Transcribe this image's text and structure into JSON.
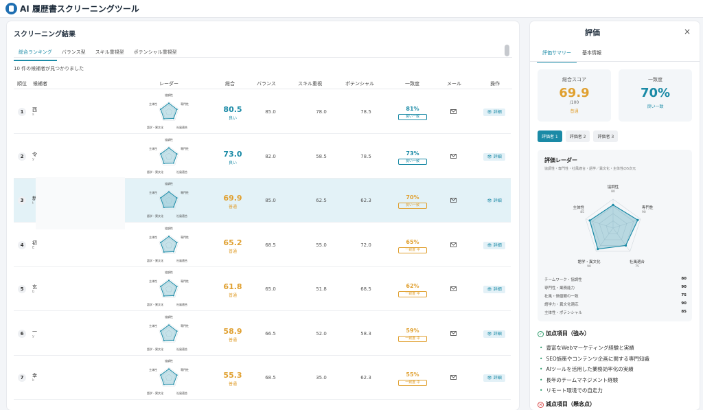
{
  "app": {
    "title": "AI 履歴書スクリーニングツール"
  },
  "left": {
    "title": "スクリーニング結果",
    "tabs": [
      "総合ランキング",
      "バランス型",
      "スキル重視型",
      "ポテンシャル重視型"
    ],
    "found": "10 件の候補者が見つかりました",
    "headers": {
      "rank": "順位",
      "candidate": "候補者",
      "radar": "レーダー",
      "total": "総合",
      "balance": "バランス",
      "skill": "スキル重視",
      "potential": "ポテンシャル",
      "match": "一致度",
      "mail": "メール",
      "action": "操作"
    },
    "radar_labels": {
      "top": "協調性",
      "right": "専門性",
      "br": "社風適合",
      "bl": "語学・異文化",
      "left": "主体性"
    },
    "detail_label": "詳細",
    "rows": [
      {
        "rank": "1",
        "name": "西",
        "sub": "s",
        "total": "80.5",
        "total_label": "良い",
        "balance": "85.0",
        "skill": "78.0",
        "potential": "78.5",
        "match": "81%",
        "match_label": "良い一致",
        "level": "good"
      },
      {
        "rank": "2",
        "name": "令",
        "sub": "y",
        "total": "73.0",
        "total_label": "良い",
        "balance": "82.0",
        "skill": "58.5",
        "potential": "78.5",
        "match": "73%",
        "match_label": "良い一致",
        "level": "good"
      },
      {
        "rank": "3",
        "name": "新",
        "sub": "t",
        "total": "69.9",
        "total_label": "普通",
        "balance": "85.0",
        "skill": "62.5",
        "potential": "62.3",
        "match": "70%",
        "match_label": "良い一致",
        "level": "mid"
      },
      {
        "rank": "4",
        "name": "初",
        "sub": "E",
        "total": "65.2",
        "total_label": "普通",
        "balance": "68.5",
        "skill": "55.0",
        "potential": "72.0",
        "match": "65%",
        "match_label": "一致度 中",
        "level": "mid"
      },
      {
        "rank": "5",
        "name": "玄",
        "sub": "b",
        "total": "61.8",
        "total_label": "普通",
        "balance": "65.0",
        "skill": "51.8",
        "potential": "68.5",
        "match": "62%",
        "match_label": "一致度 中",
        "level": "mid"
      },
      {
        "rank": "6",
        "name": "一",
        "sub": "y",
        "total": "58.9",
        "total_label": "普通",
        "balance": "66.5",
        "skill": "52.0",
        "potential": "58.3",
        "match": "59%",
        "match_label": "一致度 中",
        "level": "mid"
      },
      {
        "rank": "7",
        "name": "幸",
        "sub": "k",
        "total": "55.3",
        "total_label": "普通",
        "balance": "68.5",
        "skill": "35.0",
        "potential": "62.3",
        "match": "55%",
        "match_label": "一致度 中",
        "level": "mid"
      }
    ]
  },
  "right": {
    "title": "評価",
    "close": "×",
    "tabs": [
      "評価サマリー",
      "基本情報"
    ],
    "score_card": {
      "label": "総合スコア",
      "value": "69.9",
      "max": "/100",
      "status": "普通"
    },
    "match_card": {
      "label": "一致度",
      "value": "70%",
      "status": "良い一致"
    },
    "evaluators": [
      "評価者 1",
      "評価者 2",
      "評価者 3"
    ],
    "radar_title": "評価レーダー",
    "radar_sub": "協調性・専門性・社風適合・語学／異文化・主体性の5次元",
    "radar_axes": [
      {
        "label": "協調性",
        "value": "80"
      },
      {
        "label": "専門性",
        "value": "90"
      },
      {
        "label": "社風適合",
        "value": "75"
      },
      {
        "label": "語学・異文化",
        "value": "90"
      },
      {
        "label": "主体性",
        "value": "85"
      }
    ],
    "scores": [
      {
        "label": "チームワーク・協調性",
        "value": "80"
      },
      {
        "label": "専門性・業務能力",
        "value": "90"
      },
      {
        "label": "社風・価値観の一致",
        "value": "75"
      },
      {
        "label": "語学力・異文化適応",
        "value": "90"
      },
      {
        "label": "主体性・ポテンシャル",
        "value": "85"
      }
    ],
    "plus_title": "加点項目（強み）",
    "plus_items": [
      "豊富なWebマーケティング経験と実績",
      "SEO施策やコンテンツ企画に関する専門知識",
      "AIツールを活用した業務効率化の実績",
      "長年のチームマネジメント経験",
      "リモート環境での自走力"
    ],
    "minus_title": "減点項目（懸念点）"
  },
  "colors": {
    "accent": "#1a8aa6",
    "good": "#1a8aa6",
    "mid": "#e0a030",
    "highlight": "#e3f2f7"
  }
}
